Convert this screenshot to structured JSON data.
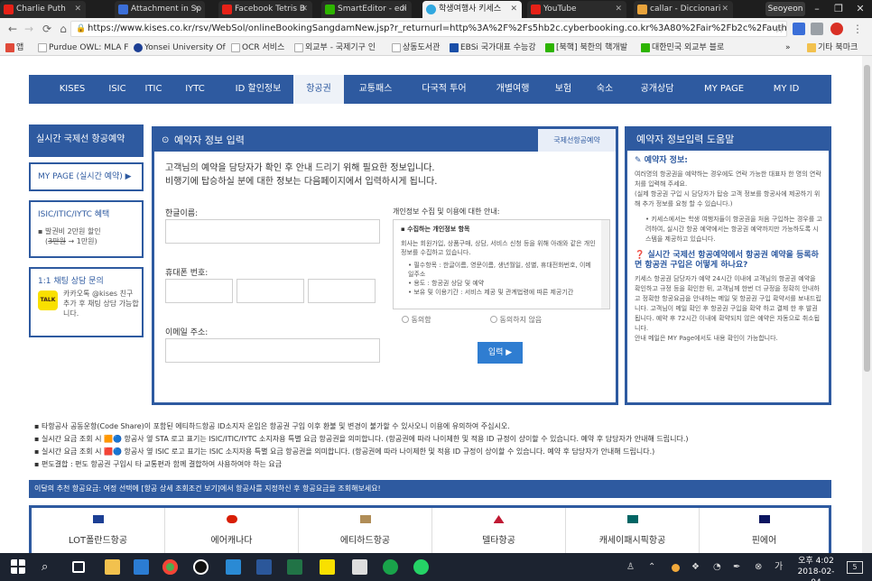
{
  "browser": {
    "tabs": [
      {
        "title": "Charlie Puth",
        "favicon": "youtube-icon",
        "color": "#e62117"
      },
      {
        "title": "Attachment in Sp",
        "favicon": "document-icon",
        "color": "#3b6fd8"
      },
      {
        "title": "Facebook Tetris B",
        "favicon": "youtube-icon",
        "color": "#e62117"
      },
      {
        "title": "SmartEditor - edi",
        "favicon": "naver-icon",
        "color": "#2db400"
      },
      {
        "title": "학생여행사 키세스",
        "favicon": "globe-icon",
        "color": "#31a8e0",
        "active": true
      },
      {
        "title": "YouTube",
        "favicon": "youtube-icon",
        "color": "#e62117"
      },
      {
        "title": "callar - Diccionari",
        "favicon": "dictionary-icon",
        "color": "#e8a33b"
      }
    ],
    "profile_name": "Seoyeon",
    "url": "https://www.kises.co.kr/rsv/WebSol/onlineBookingSangdamNew.jsp?r_returnurl=http%3A%2F%2Fs5hb2c.cyberbooking.co.kr%3A80%2Fair%2Fb2c%2Fauth%2FloginA...",
    "bookmarks": [
      {
        "label": "앱",
        "icon": "apps-icon",
        "color": "#e04a3a"
      },
      {
        "label": "Purdue OWL: MLA F",
        "icon": "page-icon",
        "color": "#ffffff"
      },
      {
        "label": "Yonsei University Of",
        "icon": "yonsei-icon",
        "color": "#1c3f94"
      },
      {
        "label": "OCR 서비스",
        "icon": "page-icon",
        "color": "#ffffff"
      },
      {
        "label": "외교부 - 국제기구 인",
        "icon": "page-icon",
        "color": "#ffffff"
      },
      {
        "label": "상동도서관",
        "icon": "page-icon",
        "color": "#ffffff"
      },
      {
        "label": "EBSi 국가대표 수능강",
        "icon": "ebsi-icon",
        "color": "#1a4fa8"
      },
      {
        "label": "[북핵] 북한의 핵개발",
        "icon": "naver-icon",
        "color": "#2db400"
      },
      {
        "label": "대한민국 외교부 블로",
        "icon": "naver-icon",
        "color": "#2db400"
      }
    ],
    "bookmarks_more": "»",
    "other_bookmarks": "기타 북마크"
  },
  "nav": {
    "items": [
      "KISES",
      "ISIC",
      "ITIC",
      "IYTC",
      "ID 할인정보",
      "항공권",
      "교통패스",
      "다국적 투어",
      "개별여행",
      "보험",
      "숙소",
      "공개상담",
      "MY PAGE",
      "MY ID"
    ],
    "active": "항공권"
  },
  "sidebar": {
    "title": "실시간 국제선 항공예약",
    "mypage": "MY PAGE (실시간 예약) ▶",
    "benefit_title": "ISIC/ITIC/IYTC 혜택",
    "benefit_line1": "▪ 발권비 2만원 할인",
    "benefit_strike": "3만원",
    "benefit_line2": " → 1만원)",
    "benefit_open": "(",
    "chat_title": "1:1 채팅 상담 문의",
    "talk_label": "TALK",
    "chat_text": "카카오톡 @kises 친구추가 후 채팅 상담 가능합니다."
  },
  "form": {
    "title": "예약자 정보 입력",
    "badge": "국제선항공예약",
    "intro1": "고객님의 예약을 담당자가 확인 후 안내 드리기 위해 필요한 정보입니다.",
    "intro2": "비행기에 탑승하실 분에 대한 정보는 다음페이지에서 입력하시게 됩니다.",
    "name_label": "한글이름:",
    "phone_label": "휴대폰 번호:",
    "email_label": "이메일 주소:",
    "privacy_title": "개인정보 수집 및 이용에 대한 안내:",
    "privacy_heading": "▪ 수집하는 개인정보 항목",
    "privacy_body": "회사는 회원가입, 상품구매, 상담, 서비스 신청 등을 위해 아래와 같은 개인정보를 수집하고 있습니다.",
    "privacy_items": [
      "필수항목 : 한글이름, 영문이름, 생년월일, 성별, 휴대전화번호, 이메일주소",
      "용도 : 항공권 상담 및 예약",
      "보유 및 이용기간 : 서비스 제공 및 관계법령에 따른 제공기간"
    ],
    "agree": "동의함",
    "disagree": "동의하지 않음",
    "submit": "입력 ▶"
  },
  "help": {
    "title": "예약자 정보입력 도움말",
    "section1_title": "예약자 정보:",
    "section1_text": "여러명의 항공권을 예약하는 경우에도 연락 가능한 대표자 한 명의 연락처를 입력해 주세요.",
    "section1_note": "(실제 항공권 구입 시 담당자가 탑승 고객 정보를 항공사에 제공하기 위해 추가 정보를 요청 할 수 있습니다.)",
    "section1_bullet": "키세스에서는 학생 여행자들이 항공권을 처음 구입하는 경우를 고려하여, 실시간 항공 예약에서는 항공권 예약까지만 가능하도록 시스템을 제공하고 있습니다.",
    "section2_title": "실시간 국제선 항공예약에서 항공권 예약을 등록하면 항공권 구입은 어떻게 하나요?",
    "section2_text": "키세스 항공권 담당자가 예약 24시간 이내에 고객님의 항공권 예약을 확인하고 규정 등을 확인한 뒤, 고객님께 한번 더 규정을 정확히 안내하고 정확한 항공요금을 안내하는 메일 및 항공권 구입 확약서를 보내드립니다. 고객님이 메일 확인 후 항공권 구입을 확약 하고 결제 한 후 발권됩니다. 예약 후 72시간 이내에 확약되지 않은 예약은 자동으로 취소됩니다.",
    "section2_note": "안내 메일은 MY Page에서도 내용 확인이 가능합니다."
  },
  "notes": [
    "▪ 타항공사 공동운항(Code Share)이 포함된 에티하드항공 ID소지자 운임은 항공권 구입 이후 환불 및 변경이 불가할 수 있사오니 이용에 유의하여 주십시오.",
    "▪ 실시간 요금 조회 시 🟧🔵 항공사 옆 STA 로고 표기는 ISIC/ITIC/IYTC 소지자용 특별 요금 항공권을 의미합니다. (항공권에 따라 나이제한 및 적용 ID 규정이 상이할 수 있습니다. 예약 후 담당자가 안내해 드립니다.)",
    "▪ 실시간 요금 조회 시 🟥🔵 항공사 옆 ISIC 로고 표기는 ISIC 소지자용 특별 요금 항공권을 의미합니다. (항공권에 따라 나이제한 및 적용 ID 규정이 상이할 수 있습니다. 예약 후 담당자가 안내해 드립니다.)",
    "▪ 편도결합 : 편도 항공권 구입시 타 교통편과 함께 결합하여 사용하여야 하는 요금"
  ],
  "promo": "이달의 추천 항공요금: 여정 선택에 [항공 상세 조회조건 보기]에서 항공사를 지정하신 후 항공요금을 조회해보세요!",
  "airlines": [
    {
      "name": "LOT폴란드항공",
      "logo_color": "#1c3f94"
    },
    {
      "name": "에어캐나다",
      "logo_color": "#d81e05"
    },
    {
      "name": "에티하드항공",
      "logo_color": "#b08d57"
    },
    {
      "name": "델타항공",
      "logo_color": "#c01933"
    },
    {
      "name": "캐세이패시픽항공",
      "logo_color": "#006564"
    },
    {
      "name": "핀에어",
      "logo_color": "#0b1560"
    }
  ],
  "taskbar": {
    "time": "오후 4:02",
    "date": "2018-02-04",
    "notification_count": "5",
    "ime": "가"
  },
  "colors": {
    "brand": "#2e5aa0",
    "submit": "#2f7dd1"
  }
}
